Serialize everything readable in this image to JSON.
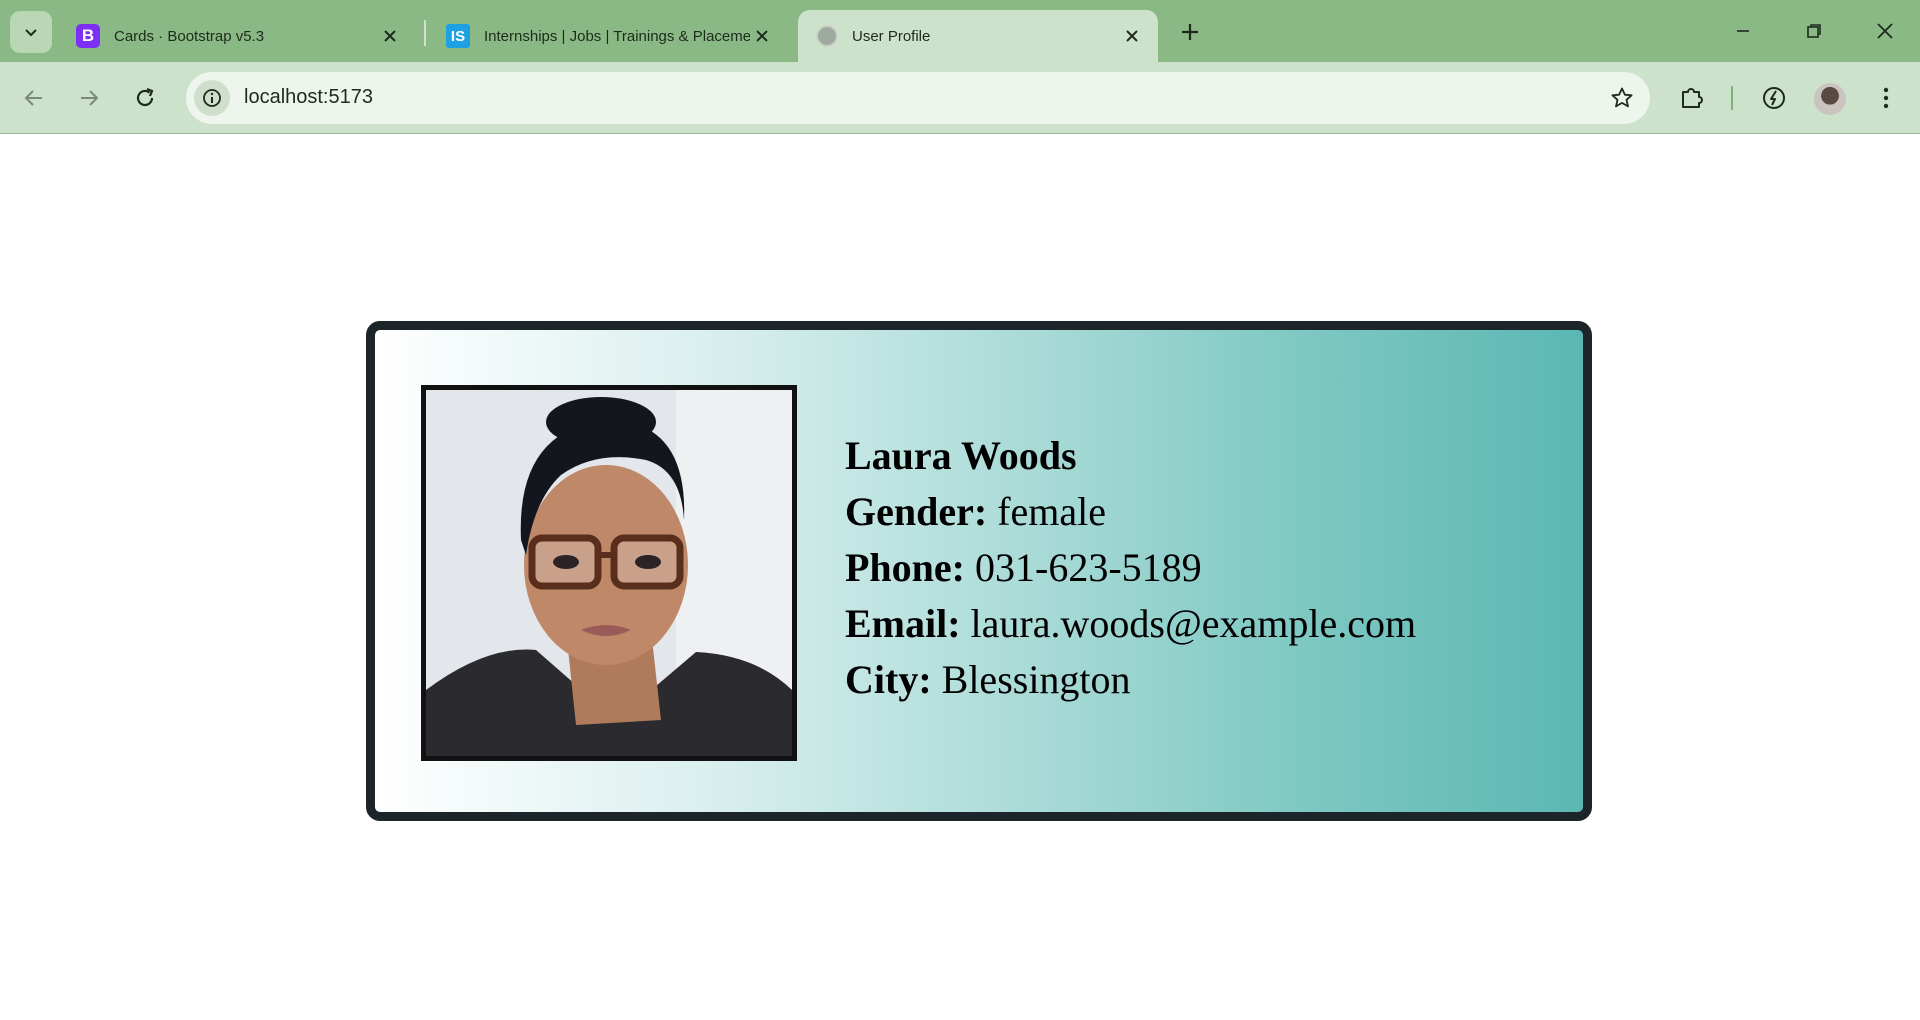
{
  "browser": {
    "tabs": [
      {
        "title": "Cards · Bootstrap v5.3",
        "favicon": "B",
        "active": false
      },
      {
        "title": "Internships | Jobs | Trainings & Placements",
        "favicon": "IS",
        "active": false
      },
      {
        "title": "User Profile",
        "favicon": "globe-icon",
        "active": true
      }
    ],
    "url": "localhost:5173",
    "colors": {
      "frame": "#8bb986",
      "toolbar": "#cde2cb",
      "active_tab": "#cde2cb"
    }
  },
  "profile": {
    "name": "Laura Woods",
    "gender_label": "Gender:",
    "gender": "female",
    "phone_label": "Phone:",
    "phone": "031-623-5189",
    "email_label": "Email:",
    "email": "laura.woods@example.com",
    "city_label": "City:",
    "city": "Blessington",
    "photo_icon": "user-portrait-photo"
  }
}
